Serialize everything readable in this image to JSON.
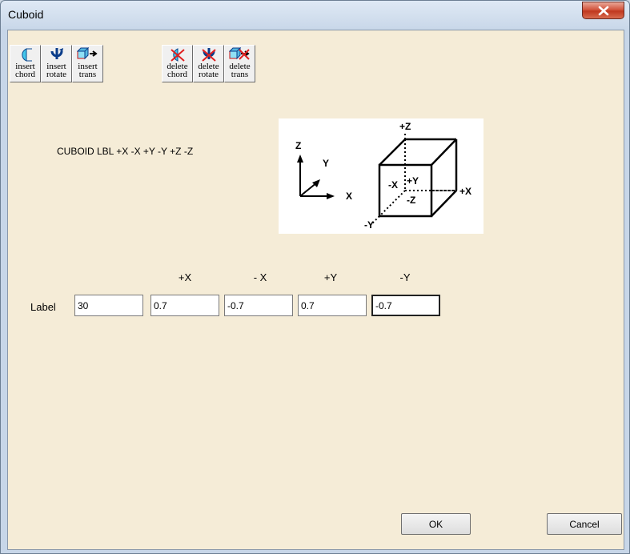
{
  "window": {
    "title": "Cuboid"
  },
  "toolbar": {
    "buttons": [
      {
        "line1": "insert",
        "line2": "chord",
        "icon": "insert-chord-icon"
      },
      {
        "line1": "insert",
        "line2": "rotate",
        "icon": "insert-rotate-icon"
      },
      {
        "line1": "insert",
        "line2": "trans",
        "icon": "insert-trans-icon"
      },
      {
        "line1": "delete",
        "line2": "chord",
        "icon": "delete-chord-icon"
      },
      {
        "line1": "delete",
        "line2": "rotate",
        "icon": "delete-rotate-icon"
      },
      {
        "line1": "delete",
        "line2": "trans",
        "icon": "delete-trans-icon"
      }
    ]
  },
  "syntax": "CUBOID LBL  +X  -X  +Y  -Y  +Z  -Z",
  "diagram": {
    "axes": {
      "z": "Z",
      "y": "Y",
      "x": "X"
    },
    "faces": {
      "pz": "+Z",
      "px": "+X",
      "mx": "-X",
      "py": "+Y",
      "mz": "-Z",
      "my": "-Y"
    }
  },
  "form": {
    "label": "Label",
    "headers": {
      "px": "+X",
      "mx": "- X",
      "py": "+Y",
      "my": "-Y"
    },
    "values": {
      "label": "30",
      "px": "0.7",
      "mx": "-0.7",
      "py": "0.7",
      "my": "-0.7"
    }
  },
  "buttons": {
    "ok": "OK",
    "cancel": "Cancel"
  },
  "colors": {
    "client_bg": "#f5ecd7",
    "close_red": "#c7452c"
  }
}
